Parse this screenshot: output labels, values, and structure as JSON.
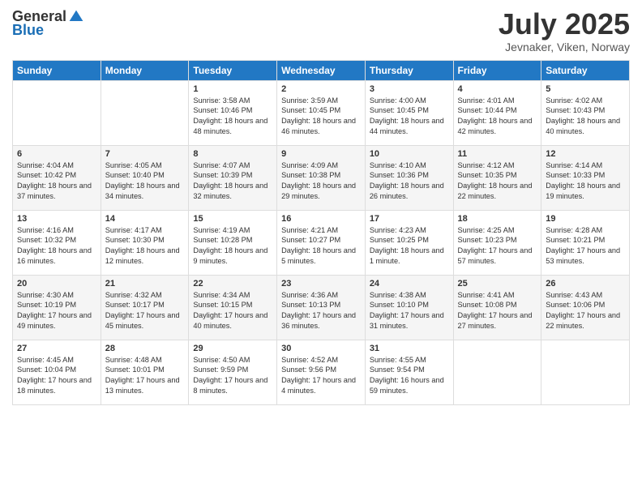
{
  "header": {
    "logo_general": "General",
    "logo_blue": "Blue",
    "title": "July 2025",
    "location": "Jevnaker, Viken, Norway"
  },
  "days_of_week": [
    "Sunday",
    "Monday",
    "Tuesday",
    "Wednesday",
    "Thursday",
    "Friday",
    "Saturday"
  ],
  "weeks": [
    [
      {
        "day": "",
        "info": ""
      },
      {
        "day": "",
        "info": ""
      },
      {
        "day": "1",
        "info": "Sunrise: 3:58 AM\nSunset: 10:46 PM\nDaylight: 18 hours and 48 minutes."
      },
      {
        "day": "2",
        "info": "Sunrise: 3:59 AM\nSunset: 10:45 PM\nDaylight: 18 hours and 46 minutes."
      },
      {
        "day": "3",
        "info": "Sunrise: 4:00 AM\nSunset: 10:45 PM\nDaylight: 18 hours and 44 minutes."
      },
      {
        "day": "4",
        "info": "Sunrise: 4:01 AM\nSunset: 10:44 PM\nDaylight: 18 hours and 42 minutes."
      },
      {
        "day": "5",
        "info": "Sunrise: 4:02 AM\nSunset: 10:43 PM\nDaylight: 18 hours and 40 minutes."
      }
    ],
    [
      {
        "day": "6",
        "info": "Sunrise: 4:04 AM\nSunset: 10:42 PM\nDaylight: 18 hours and 37 minutes."
      },
      {
        "day": "7",
        "info": "Sunrise: 4:05 AM\nSunset: 10:40 PM\nDaylight: 18 hours and 34 minutes."
      },
      {
        "day": "8",
        "info": "Sunrise: 4:07 AM\nSunset: 10:39 PM\nDaylight: 18 hours and 32 minutes."
      },
      {
        "day": "9",
        "info": "Sunrise: 4:09 AM\nSunset: 10:38 PM\nDaylight: 18 hours and 29 minutes."
      },
      {
        "day": "10",
        "info": "Sunrise: 4:10 AM\nSunset: 10:36 PM\nDaylight: 18 hours and 26 minutes."
      },
      {
        "day": "11",
        "info": "Sunrise: 4:12 AM\nSunset: 10:35 PM\nDaylight: 18 hours and 22 minutes."
      },
      {
        "day": "12",
        "info": "Sunrise: 4:14 AM\nSunset: 10:33 PM\nDaylight: 18 hours and 19 minutes."
      }
    ],
    [
      {
        "day": "13",
        "info": "Sunrise: 4:16 AM\nSunset: 10:32 PM\nDaylight: 18 hours and 16 minutes."
      },
      {
        "day": "14",
        "info": "Sunrise: 4:17 AM\nSunset: 10:30 PM\nDaylight: 18 hours and 12 minutes."
      },
      {
        "day": "15",
        "info": "Sunrise: 4:19 AM\nSunset: 10:28 PM\nDaylight: 18 hours and 9 minutes."
      },
      {
        "day": "16",
        "info": "Sunrise: 4:21 AM\nSunset: 10:27 PM\nDaylight: 18 hours and 5 minutes."
      },
      {
        "day": "17",
        "info": "Sunrise: 4:23 AM\nSunset: 10:25 PM\nDaylight: 18 hours and 1 minute."
      },
      {
        "day": "18",
        "info": "Sunrise: 4:25 AM\nSunset: 10:23 PM\nDaylight: 17 hours and 57 minutes."
      },
      {
        "day": "19",
        "info": "Sunrise: 4:28 AM\nSunset: 10:21 PM\nDaylight: 17 hours and 53 minutes."
      }
    ],
    [
      {
        "day": "20",
        "info": "Sunrise: 4:30 AM\nSunset: 10:19 PM\nDaylight: 17 hours and 49 minutes."
      },
      {
        "day": "21",
        "info": "Sunrise: 4:32 AM\nSunset: 10:17 PM\nDaylight: 17 hours and 45 minutes."
      },
      {
        "day": "22",
        "info": "Sunrise: 4:34 AM\nSunset: 10:15 PM\nDaylight: 17 hours and 40 minutes."
      },
      {
        "day": "23",
        "info": "Sunrise: 4:36 AM\nSunset: 10:13 PM\nDaylight: 17 hours and 36 minutes."
      },
      {
        "day": "24",
        "info": "Sunrise: 4:38 AM\nSunset: 10:10 PM\nDaylight: 17 hours and 31 minutes."
      },
      {
        "day": "25",
        "info": "Sunrise: 4:41 AM\nSunset: 10:08 PM\nDaylight: 17 hours and 27 minutes."
      },
      {
        "day": "26",
        "info": "Sunrise: 4:43 AM\nSunset: 10:06 PM\nDaylight: 17 hours and 22 minutes."
      }
    ],
    [
      {
        "day": "27",
        "info": "Sunrise: 4:45 AM\nSunset: 10:04 PM\nDaylight: 17 hours and 18 minutes."
      },
      {
        "day": "28",
        "info": "Sunrise: 4:48 AM\nSunset: 10:01 PM\nDaylight: 17 hours and 13 minutes."
      },
      {
        "day": "29",
        "info": "Sunrise: 4:50 AM\nSunset: 9:59 PM\nDaylight: 17 hours and 8 minutes."
      },
      {
        "day": "30",
        "info": "Sunrise: 4:52 AM\nSunset: 9:56 PM\nDaylight: 17 hours and 4 minutes."
      },
      {
        "day": "31",
        "info": "Sunrise: 4:55 AM\nSunset: 9:54 PM\nDaylight: 16 hours and 59 minutes."
      },
      {
        "day": "",
        "info": ""
      },
      {
        "day": "",
        "info": ""
      }
    ]
  ]
}
